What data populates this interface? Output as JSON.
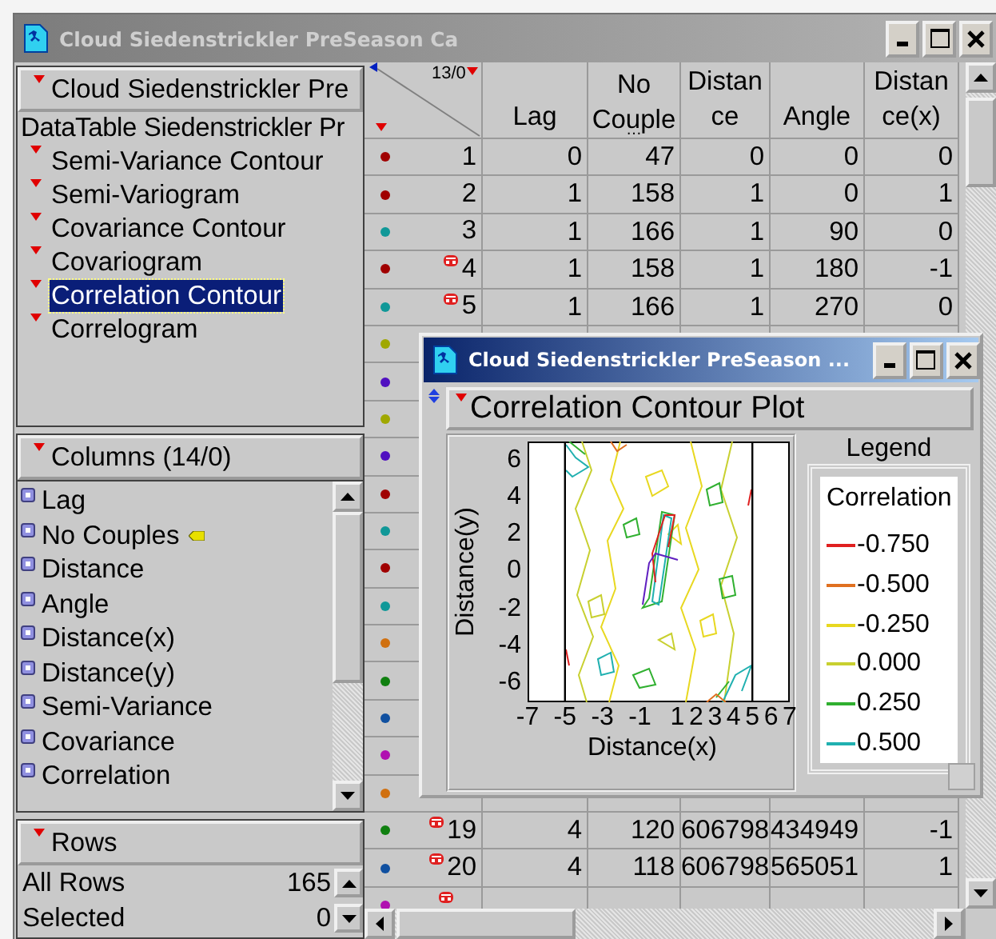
{
  "window": {
    "title": "Cloud Siedenstrickler PreSeason Ca",
    "active": false
  },
  "sidebar": {
    "header": "Cloud Siedenstrickler Pre",
    "source": "DataTable Siedenstrickler Pr",
    "items": [
      {
        "label": "Semi-Variance Contour",
        "selected": false
      },
      {
        "label": "Semi-Variogram",
        "selected": false
      },
      {
        "label": "Covariance Contour",
        "selected": false
      },
      {
        "label": "Covariogram",
        "selected": false
      },
      {
        "label": "Correlation Contour",
        "selected": true
      },
      {
        "label": "Correlogram",
        "selected": false
      }
    ]
  },
  "columns_panel": {
    "header": "Columns (14/0)",
    "items": [
      {
        "label": "Lag",
        "tagged": false
      },
      {
        "label": "No Couples",
        "tagged": true
      },
      {
        "label": "Distance",
        "tagged": false
      },
      {
        "label": "Angle",
        "tagged": false
      },
      {
        "label": "Distance(x)",
        "tagged": false
      },
      {
        "label": "Distance(y)",
        "tagged": false
      },
      {
        "label": "Semi-Variance",
        "tagged": false
      },
      {
        "label": "Covariance",
        "tagged": false
      },
      {
        "label": "Correlation",
        "tagged": false
      }
    ]
  },
  "rows_panel": {
    "header": "Rows",
    "counts": [
      {
        "label": "All Rows",
        "value": "165"
      },
      {
        "label": "Selected",
        "value": "0"
      }
    ]
  },
  "table": {
    "corner": "13/0",
    "columns": [
      {
        "lines": [
          "Lag"
        ]
      },
      {
        "lines": [
          "No",
          "Couple",
          "…"
        ]
      },
      {
        "lines": [
          "Distan",
          "ce"
        ]
      },
      {
        "lines": [
          "Angle"
        ]
      },
      {
        "lines": [
          "Distan",
          "ce(x)"
        ]
      }
    ],
    "rows": [
      {
        "number": "1",
        "color": "#a00000",
        "marked": false,
        "cells": [
          "0",
          "47",
          "0",
          "0",
          "0"
        ]
      },
      {
        "number": "2",
        "color": "#a00000",
        "marked": false,
        "cells": [
          "1",
          "158",
          "1",
          "0",
          "1"
        ]
      },
      {
        "number": "3",
        "color": "#109898",
        "marked": false,
        "cells": [
          "1",
          "166",
          "1",
          "90",
          "0"
        ]
      },
      {
        "number": "4",
        "color": "#a00000",
        "marked": true,
        "cells": [
          "1",
          "158",
          "1",
          "180",
          "-1"
        ]
      },
      {
        "number": "5",
        "color": "#109898",
        "marked": true,
        "cells": [
          "1",
          "166",
          "1",
          "270",
          "0"
        ]
      },
      {
        "color": "#a0a800"
      },
      {
        "color": "#5010c0"
      },
      {
        "color": "#a0a800"
      },
      {
        "color": "#5010c0"
      },
      {
        "color": "#a00000"
      },
      {
        "color": "#109898"
      },
      {
        "color": "#a00000"
      },
      {
        "color": "#109898"
      },
      {
        "color": "#d07010"
      },
      {
        "color": "#108010"
      },
      {
        "color": "#1050a0"
      },
      {
        "color": "#b010b0"
      },
      {
        "color": "#d07010"
      },
      {
        "number": "19",
        "color": "#108010",
        "marked": true,
        "cells": [
          "4",
          "120",
          "606798",
          "434949",
          "-1"
        ]
      },
      {
        "number": "20",
        "color": "#1050a0",
        "marked": true,
        "cells": [
          "4",
          "118",
          "606798",
          "565051",
          "1"
        ]
      },
      {
        "color": "#b010b0",
        "marked": true
      }
    ]
  },
  "plot_window": {
    "title": "Cloud Siedenstrickler PreSeason ...",
    "active": true,
    "outline": "Correlation Contour Plot",
    "plot": {
      "ylabel": "Distance(y)",
      "xlabel": "Distance(x)",
      "yticks": [
        "6",
        "4",
        "2",
        "0",
        "-2",
        "-4",
        "-6"
      ],
      "xticks": [
        "-7",
        "-5",
        "-3",
        "-1",
        "1",
        "2",
        "3",
        "4",
        "5",
        "6",
        "7"
      ]
    },
    "legend": {
      "title": "Legend",
      "heading": "Correlation",
      "entries": [
        {
          "label": "-0.750",
          "color": "#e02020"
        },
        {
          "label": "-0.500",
          "color": "#e07020"
        },
        {
          "label": "-0.250",
          "color": "#e8d820"
        },
        {
          "label": "0.000",
          "color": "#c8d030"
        },
        {
          "label": "0.250",
          "color": "#30b030"
        },
        {
          "label": "0.500",
          "color": "#20b0b0"
        }
      ]
    }
  }
}
